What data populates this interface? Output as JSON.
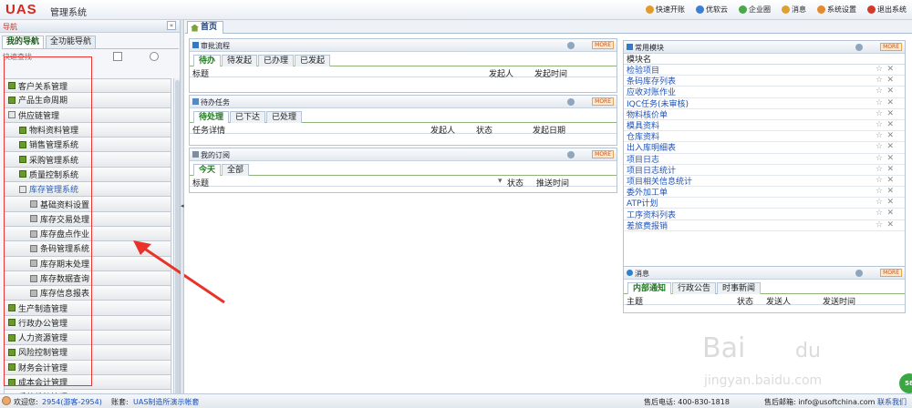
{
  "app": {
    "logo": "UAS",
    "title": "管理系统"
  },
  "topnav": [
    {
      "label": "快速开账",
      "icon": "lightning-icon",
      "color": "#e29a2a"
    },
    {
      "label": "优软云",
      "icon": "cloud-icon",
      "color": "#3a7fd5"
    },
    {
      "label": "企业圈",
      "icon": "circle-icon",
      "color": "#4aa84a"
    },
    {
      "label": "消息",
      "icon": "message-icon",
      "color": "#e0a030"
    },
    {
      "label": "系统设置",
      "icon": "tools-icon",
      "color": "#e38b2a"
    },
    {
      "label": "退出系统",
      "icon": "power-icon",
      "color": "#d23b2a"
    }
  ],
  "sidebar": {
    "header": "导航",
    "tabs": [
      {
        "label": "我的导航"
      },
      {
        "label": "全功能导航"
      }
    ],
    "search_placeholder": "快速查找",
    "items": [
      {
        "label": "客户关系管理",
        "level": 1
      },
      {
        "label": "产品生命周期",
        "level": 1
      },
      {
        "label": "供应链管理",
        "level": 1,
        "open": true
      },
      {
        "label": "物料资料管理",
        "level": 2
      },
      {
        "label": "销售管理系统",
        "level": 2
      },
      {
        "label": "采购管理系统",
        "level": 2
      },
      {
        "label": "质量控制系统",
        "level": 2
      },
      {
        "label": "库存管理系统",
        "level": 2,
        "open": true
      },
      {
        "label": "基础资料设置",
        "level": 3
      },
      {
        "label": "库存交易处理",
        "level": 3
      },
      {
        "label": "库存盘点作业",
        "level": 3
      },
      {
        "label": "条码管理系统",
        "level": 3
      },
      {
        "label": "库存期末处理",
        "level": 3
      },
      {
        "label": "库存数据查询",
        "level": 3
      },
      {
        "label": "库存信息报表",
        "level": 3
      },
      {
        "label": "生产制造管理",
        "level": 1
      },
      {
        "label": "行政办公管理",
        "level": 1
      },
      {
        "label": "人力资源管理",
        "level": 1
      },
      {
        "label": "风险控制管理",
        "level": 1
      },
      {
        "label": "财务会计管理",
        "level": 1
      },
      {
        "label": "成本会计管理",
        "level": 1
      },
      {
        "label": "系统维护管理",
        "level": 1
      }
    ]
  },
  "main_tab": "首页",
  "more_label": "MORE",
  "approval": {
    "title": "审批流程",
    "tabs": [
      "待办",
      "待发起",
      "已办理",
      "已发起"
    ],
    "columns": [
      "标题",
      "发起人",
      "发起时间"
    ]
  },
  "tasks": {
    "title": "待办任务",
    "tabs": [
      "待处理",
      "已下达",
      "已处理"
    ],
    "columns": [
      "任务详情",
      "发起人",
      "状态",
      "发起日期"
    ]
  },
  "subscribe": {
    "title": "我的订阅",
    "tabs": [
      "今天",
      "全部"
    ],
    "columns": [
      "标题",
      "状态",
      "推送时间"
    ]
  },
  "modules": {
    "title": "常用模块",
    "column": "模块名",
    "items": [
      "检验项目",
      "条码库存列表",
      "应收对账作业",
      "IQC任务(未审核)",
      "物料核价单",
      "模具资料",
      "仓库资料",
      "出入库明细表",
      "项目日志",
      "项目日志统计",
      "项目相关信息统计",
      "委外加工单",
      "ATP计划",
      "工序资料列表",
      "差旅费报销"
    ]
  },
  "messages": {
    "title": "消息",
    "tabs": [
      "内部通知",
      "行政公告",
      "时事新闻"
    ],
    "columns": [
      "主题",
      "状态",
      "发送人",
      "发送时间"
    ]
  },
  "status": {
    "welcome": "欢迎您:",
    "user": "2954(游客-2954)",
    "account_label": "账套:",
    "account": "UAS制造所演示帐套",
    "phone": "售后电话: 400-830-1818",
    "email": "售后邮箱: info@usoftchina.com",
    "contact": "联系我们"
  },
  "colors": {
    "brand": "#d8261c",
    "accent": "#1d7a1d",
    "link": "#1f52b8"
  }
}
